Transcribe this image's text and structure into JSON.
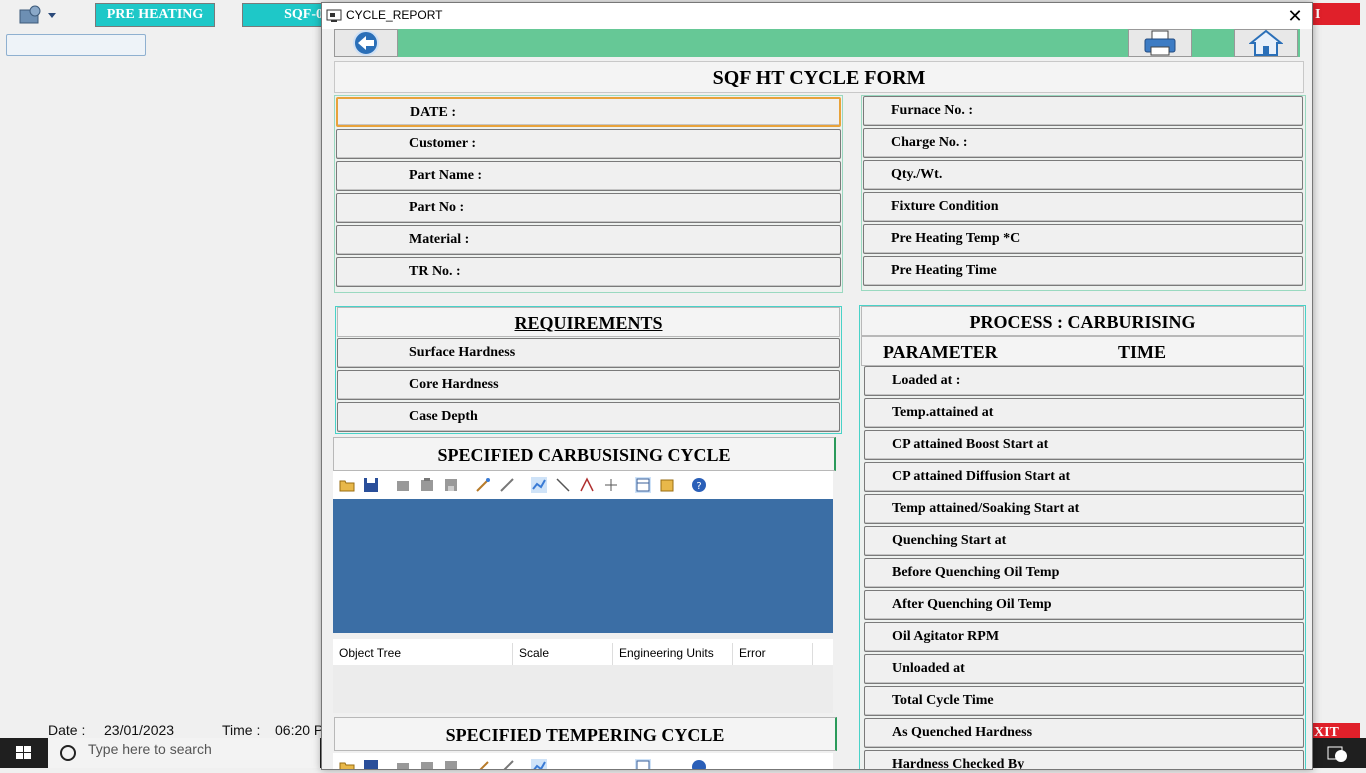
{
  "background": {
    "tab_preheating": "PRE HEATING",
    "tab_sqf": "SQF-0",
    "tab_right": "I",
    "exit_label": "XIT",
    "status_date_label": "Date  :",
    "status_date_value": "23/01/2023",
    "status_time_label": "Time  :",
    "status_time_value": "06:20 P",
    "search_placeholder": "Type here to search"
  },
  "dialog": {
    "title": "CYCLE_REPORT",
    "close_symbol": "✕"
  },
  "form": {
    "title": "SQF HT CYCLE FORM",
    "left_fields": [
      "DATE :",
      "Customer :",
      "Part Name :",
      "Part No :",
      "Material :",
      "TR No. :"
    ],
    "right_fields": [
      "Furnace No. :",
      "Charge No. :",
      "Qty./Wt.",
      "Fixture Condition",
      "Pre Heating Temp *C",
      "Pre Heating Time"
    ],
    "requirements": {
      "heading": "REQUIREMENTS",
      "items": [
        "Surface Hardness",
        "Core Hardness",
        "Case Depth"
      ]
    },
    "process": {
      "heading": "PROCESS : CARBURISING",
      "col_parameter": "PARAMETER",
      "col_time": "TIME",
      "items": [
        "Loaded at :",
        "Temp.attained at",
        "CP attained Boost Start at",
        "CP attained Diffusion Start at",
        "Temp attained/Soaking Start at",
        "Quenching Start at",
        "Before Quenching Oil Temp",
        "After Quenching Oil Temp",
        "Oil Agitator RPM",
        "Unloaded at",
        "Total Cycle Time",
        "As Quenched Hardness",
        "Hardness Checked By"
      ]
    },
    "carb_cycle_heading": "SPECIFIED CARBUSISING CYCLE",
    "temper_cycle_heading": "SPECIFIED TEMPERING CYCLE",
    "grid_columns": [
      "Object Tree",
      "Scale",
      "Engineering Units",
      "Error"
    ]
  },
  "colors": {
    "accent_green": "#66c896",
    "chart_blue": "#3b6ea5",
    "cyan": "#1ec8c8",
    "exit_red": "#e0202a"
  }
}
